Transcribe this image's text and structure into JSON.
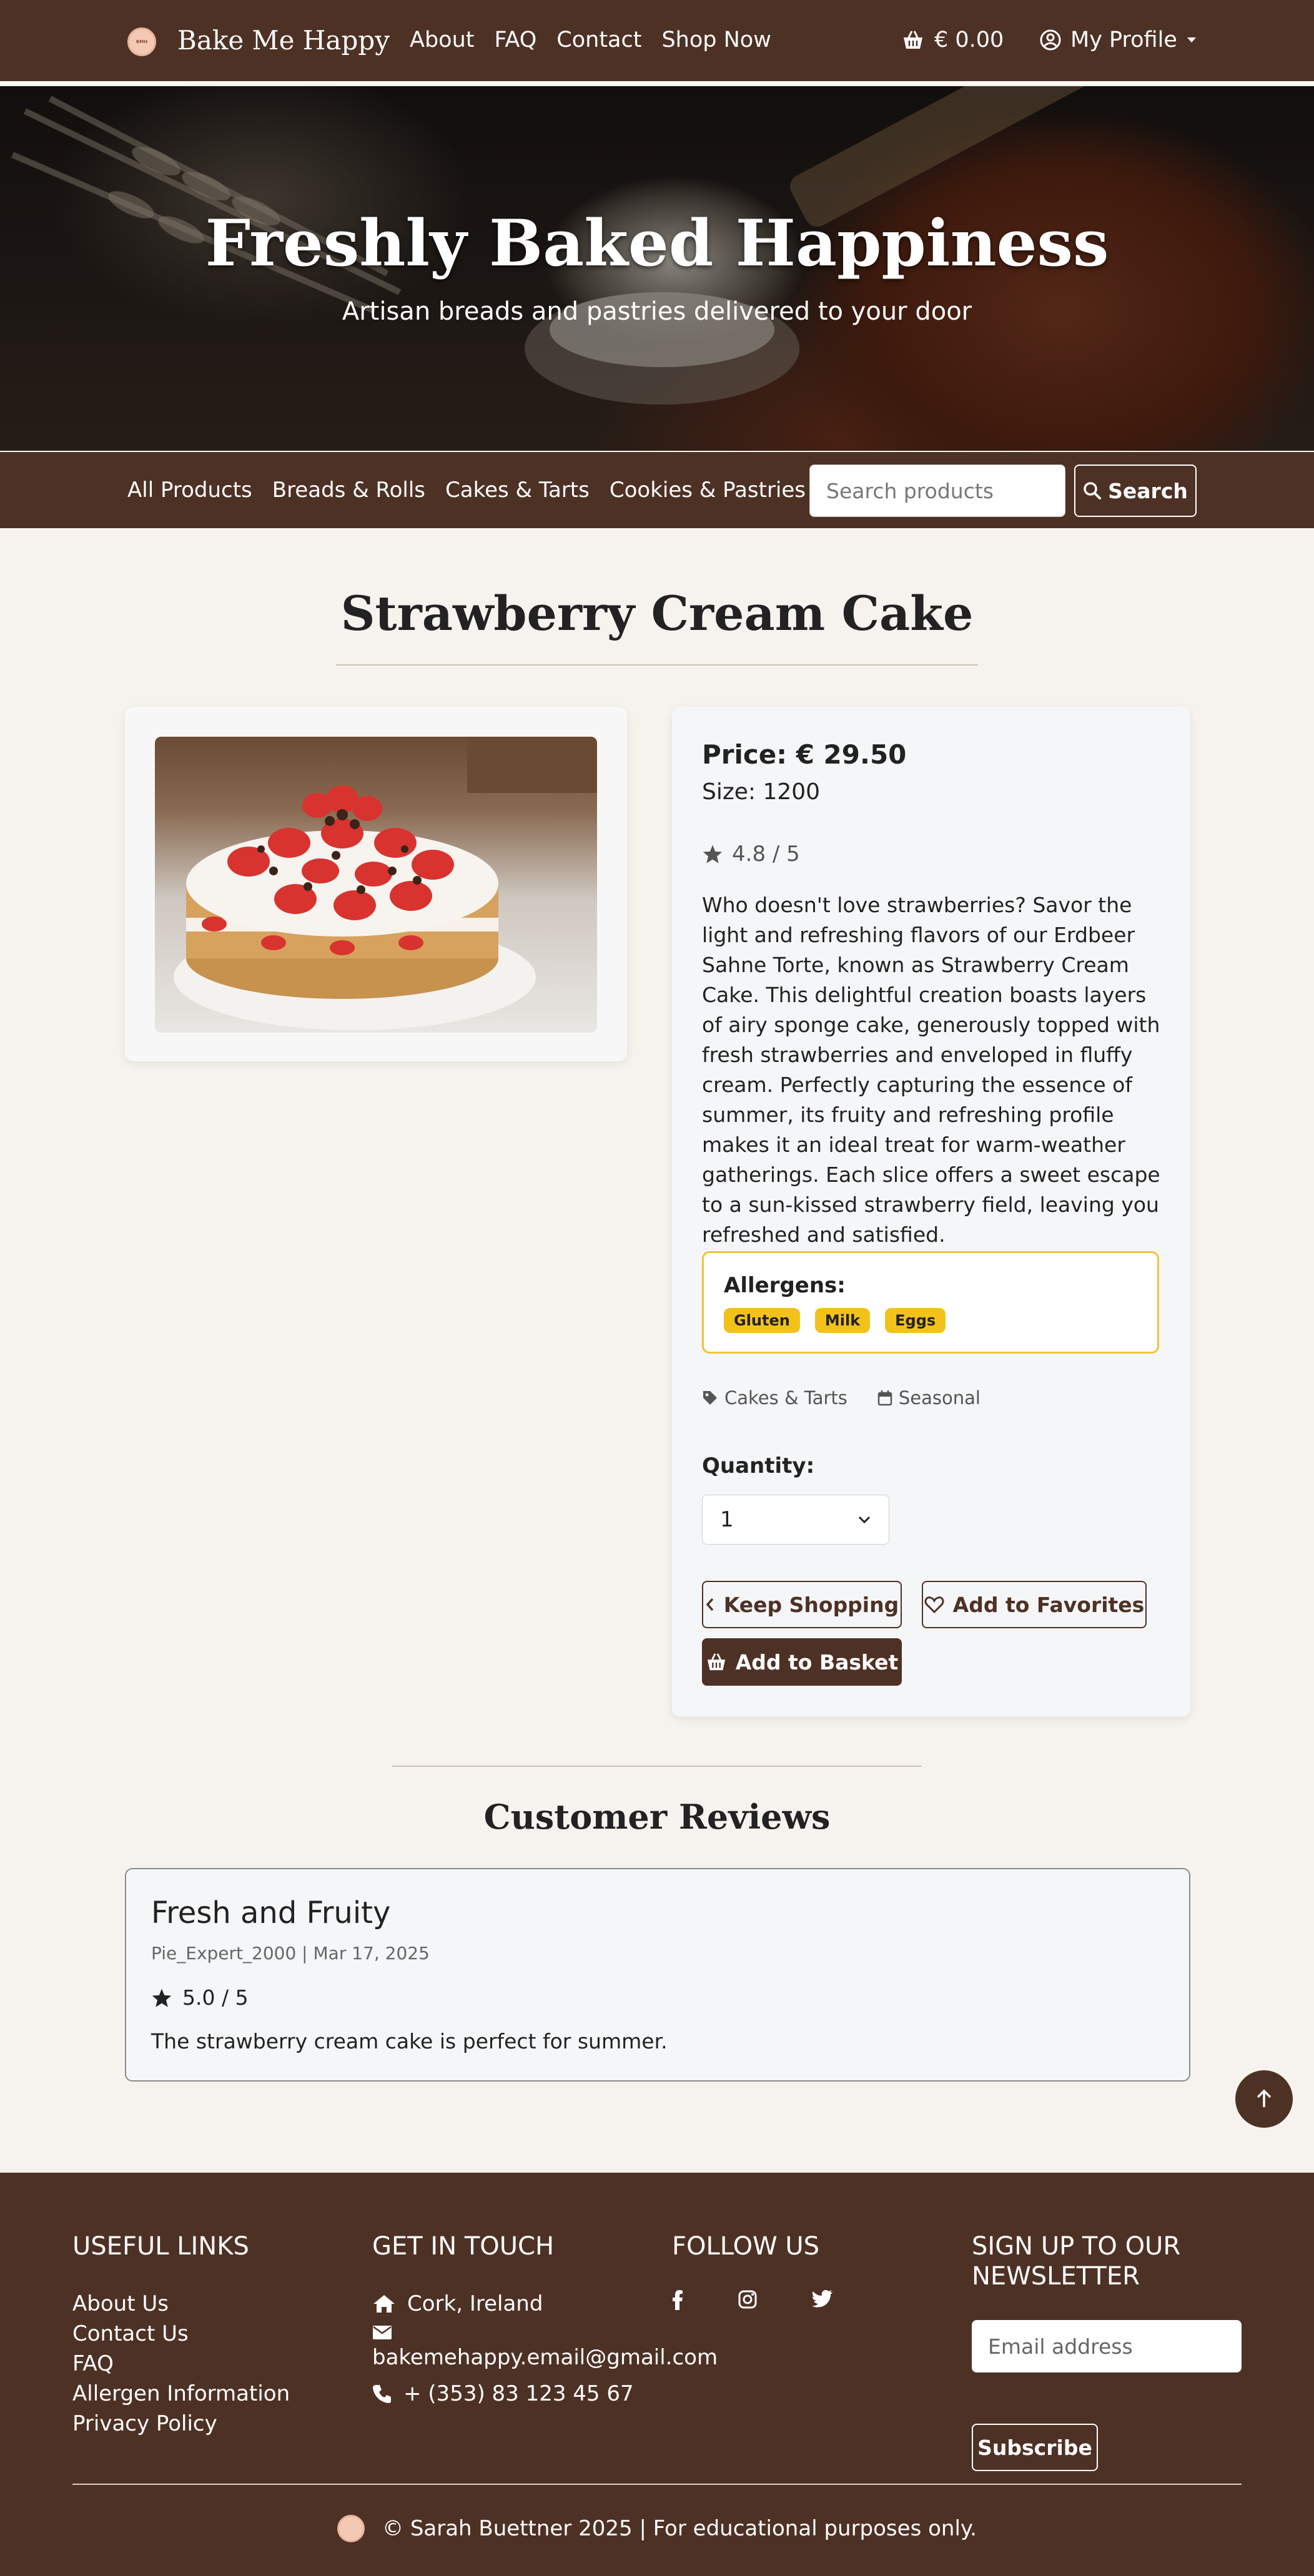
{
  "navbar": {
    "brand": "Bake Me Happy",
    "logo_icon": "bakery-logo-icon",
    "links": [
      "About",
      "FAQ",
      "Contact",
      "Shop Now"
    ],
    "cart_total": "€ 0.00",
    "cart_icon": "basket-icon",
    "profile_label": "My Profile",
    "profile_icon": "user-circle-icon"
  },
  "hero": {
    "title": "Freshly Baked Happiness",
    "subtitle": "Artisan breads and pastries delivered to your door"
  },
  "categories": {
    "links": [
      "All Products",
      "Breads & Rolls",
      "Cakes & Tarts",
      "Cookies & Pastries"
    ],
    "search_placeholder": "Search products",
    "search_label": "Search"
  },
  "product": {
    "title": "Strawberry Cream Cake",
    "price": "Price: € 29.50",
    "size": "Size: 1200",
    "rating": "4.8 / 5",
    "description": "Who doesn't love strawberries? Savor the light and refreshing flavors of our Erdbeer Sahne Torte, known as Strawberry Cream Cake. This delightful creation boasts layers of airy sponge cake, generously topped with fresh strawberries and enveloped in fluffy cream. Perfectly capturing the essence of summer, its fruity and refreshing profile makes it an ideal treat for warm-weather gatherings. Each slice offers a sweet escape to a sun-kissed strawberry field, leaving you refreshed and satisfied.",
    "allergens_label": "Allergens:",
    "allergens": [
      "Gluten",
      "Milk",
      "Eggs"
    ],
    "category_tag": "Cakes & Tarts",
    "season_tag": "Seasonal",
    "quantity_label": "Quantity:",
    "quantity_value": "1",
    "keep_shopping": "Keep Shopping",
    "add_favorites": "Add to Favorites",
    "add_basket": "Add to Basket"
  },
  "reviews": {
    "heading": "Customer Reviews",
    "items": [
      {
        "title": "Fresh and Fruity",
        "meta": "Pie_Expert_2000 | Mar 17, 2025",
        "rating": "5.0 / 5",
        "text": "The strawberry cream cake is perfect for summer."
      }
    ]
  },
  "footer": {
    "useful_links_heading": "USEFUL LINKS",
    "useful_links": [
      "About Us",
      "Contact Us",
      "FAQ",
      "Allergen Information",
      "Privacy Policy"
    ],
    "contact_heading": "GET IN TOUCH",
    "address": "Cork, Ireland",
    "email": "bakemehappy.email@gmail.com",
    "phone": "+ (353) 83 123 45 67",
    "follow_heading": "FOLLOW US",
    "social_icons": [
      "facebook-icon",
      "instagram-icon",
      "twitter-icon"
    ],
    "newsletter_heading": "SIGN UP TO OUR NEWSLETTER",
    "newsletter_placeholder": "Email address",
    "subscribe_label": "Subscribe",
    "copyright": "© Sarah Buettner 2025 | For educational purposes only."
  },
  "colors": {
    "brand_brown": "#4e3125",
    "page_bg": "#f6f3ee",
    "allergen_yellow": "#f2c21b"
  }
}
